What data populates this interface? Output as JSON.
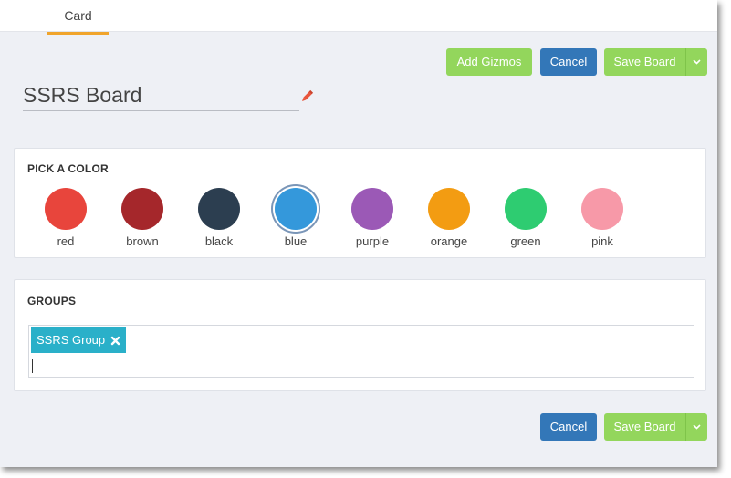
{
  "tabs": [
    {
      "label": "Card"
    }
  ],
  "toolbar": {
    "add_gizmos": "Add Gizmos",
    "cancel": "Cancel",
    "save_board": "Save Board"
  },
  "board": {
    "title": "SSRS Board"
  },
  "color_picker": {
    "title": "PICK A COLOR",
    "selected": "blue",
    "colors": [
      {
        "name": "red",
        "hex": "#e8453c"
      },
      {
        "name": "brown",
        "hex": "#a5272b"
      },
      {
        "name": "black",
        "hex": "#2c3e50"
      },
      {
        "name": "blue",
        "hex": "#3498db"
      },
      {
        "name": "purple",
        "hex": "#9b59b6"
      },
      {
        "name": "orange",
        "hex": "#f39c12"
      },
      {
        "name": "green",
        "hex": "#2ecc71"
      },
      {
        "name": "pink",
        "hex": "#f799a8"
      }
    ]
  },
  "groups": {
    "title": "GROUPS",
    "tags": [
      {
        "label": "SSRS Group"
      }
    ]
  },
  "footer": {
    "cancel": "Cancel",
    "save_board": "Save Board"
  },
  "theme": {
    "accent_tab": "#f0a42b",
    "green_button": "#93d65c",
    "blue_button": "#3377b8",
    "tag": "#2ab0c9",
    "edit_icon": "#e8553c"
  }
}
